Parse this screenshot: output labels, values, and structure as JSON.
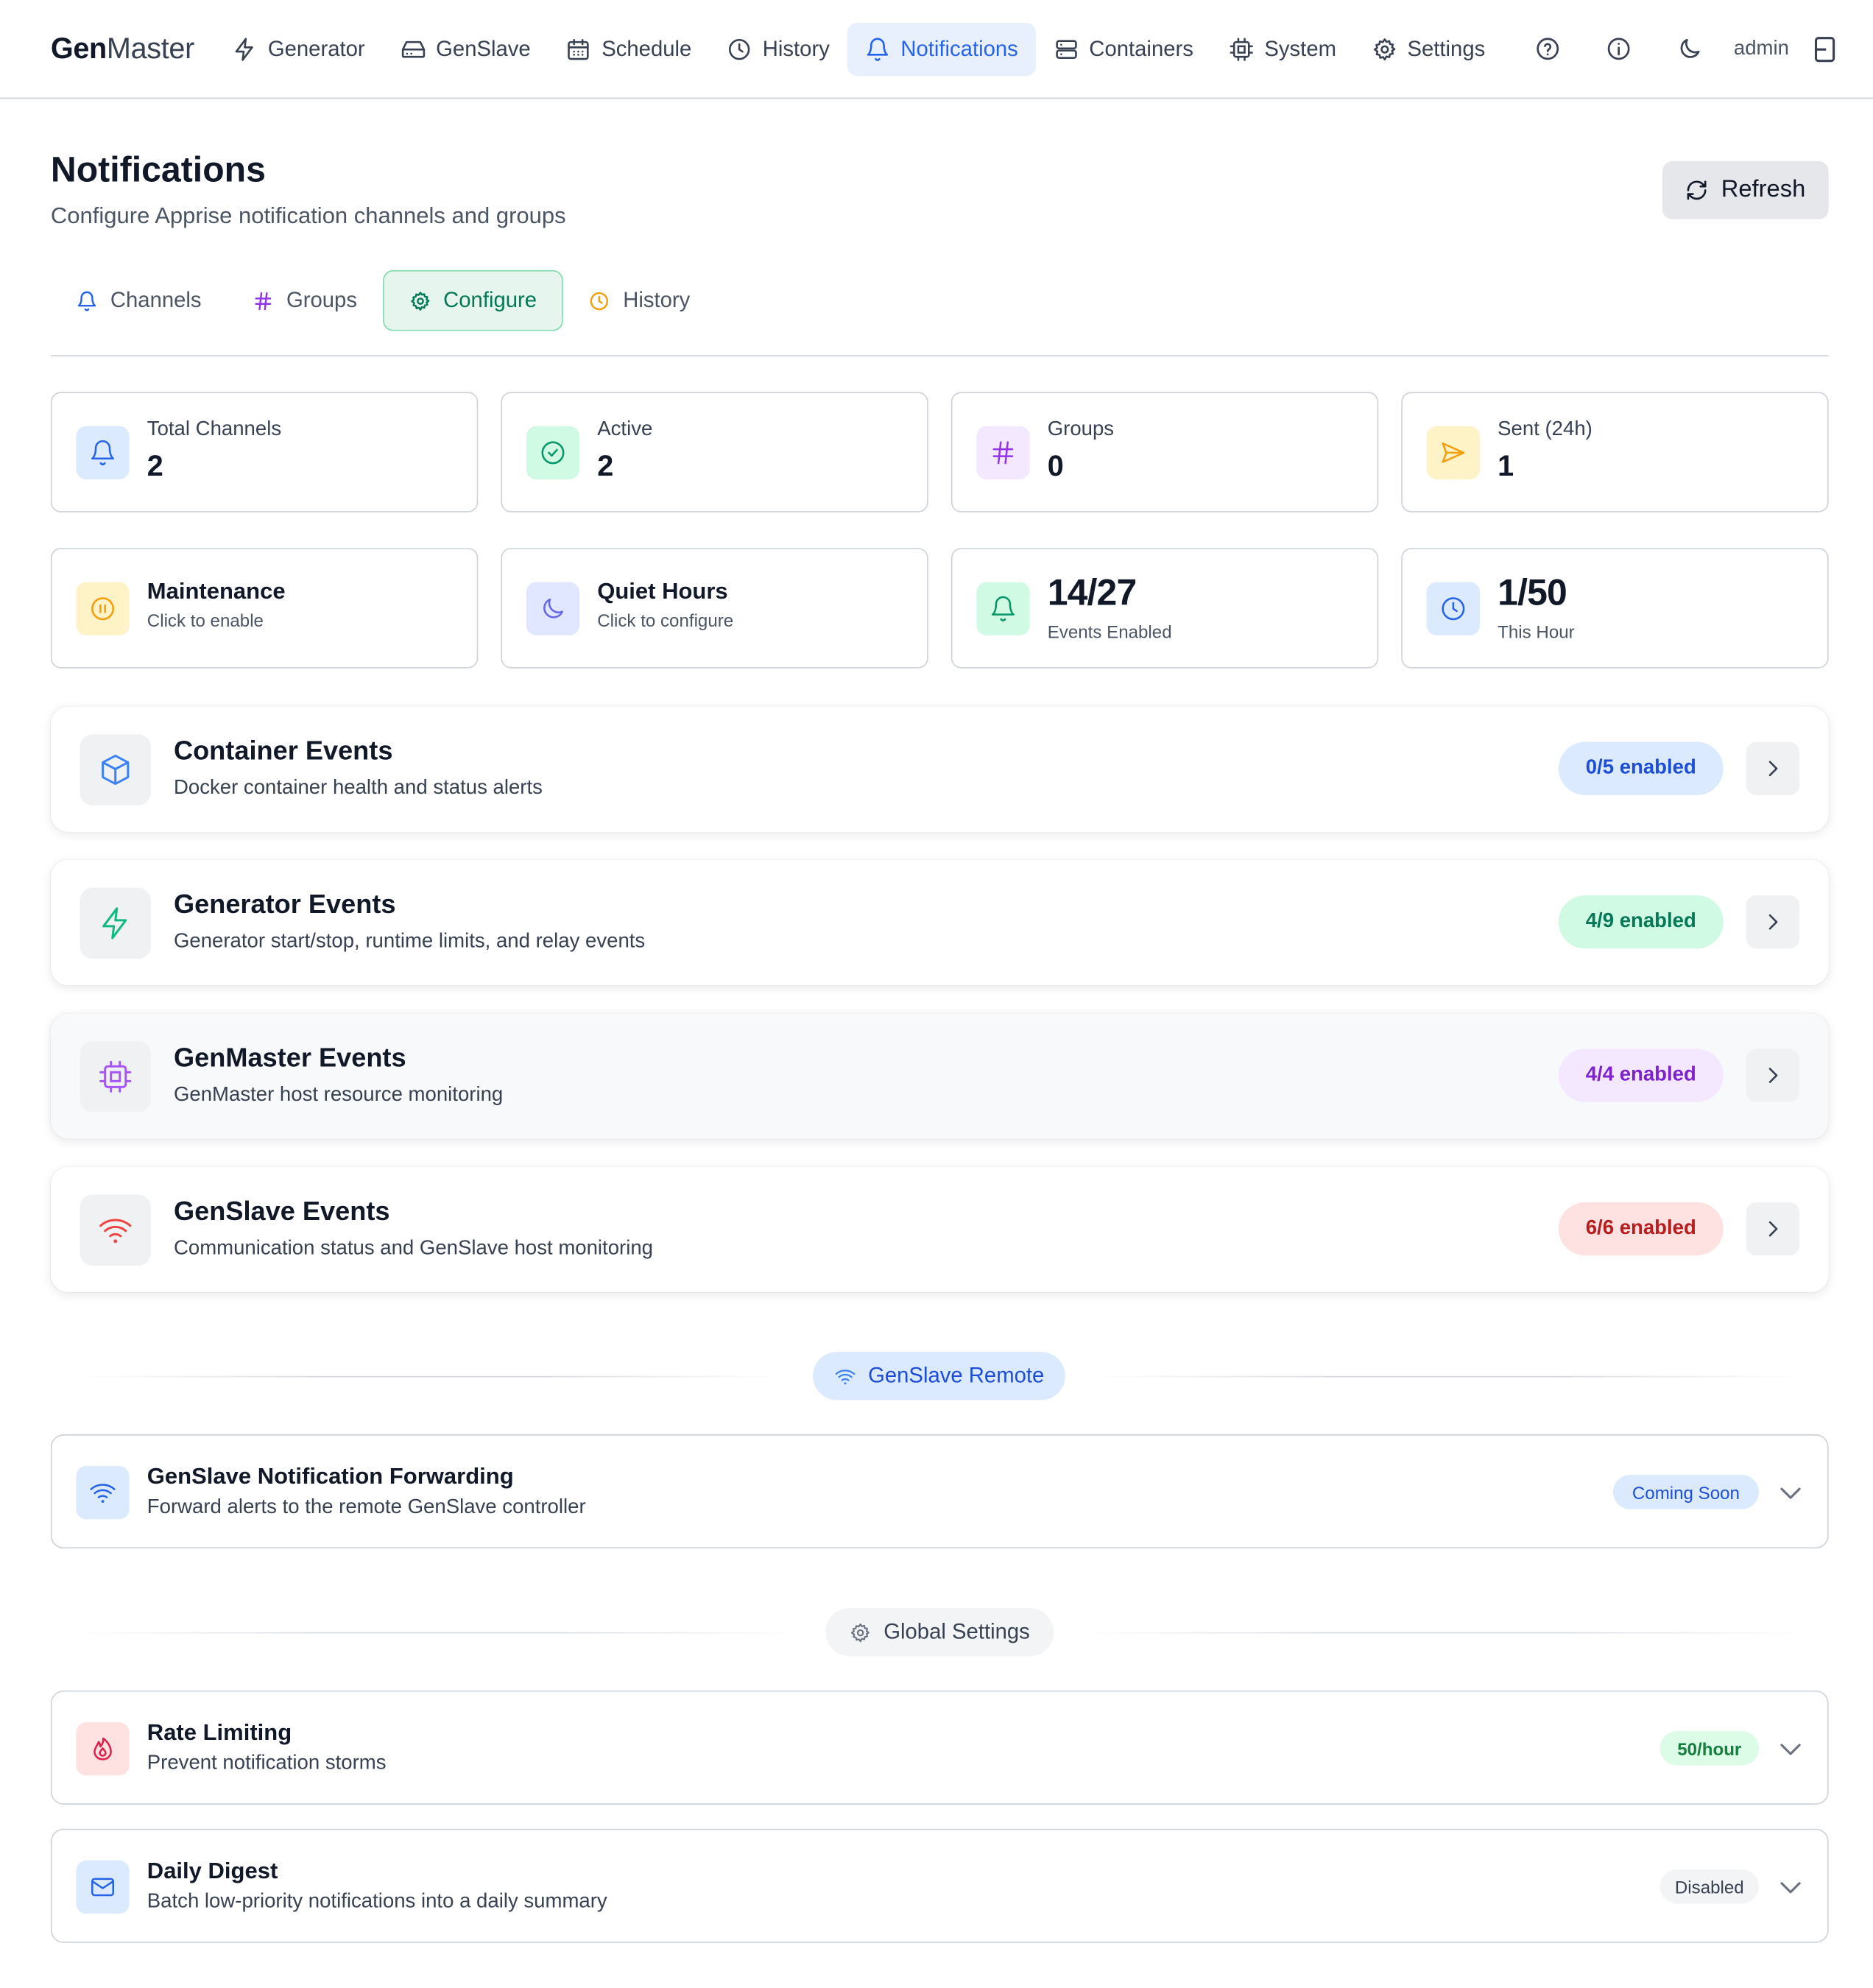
{
  "brand": {
    "bold": "Gen",
    "light": "Master"
  },
  "nav": {
    "items": [
      {
        "label": "Generator",
        "icon": "zap-icon",
        "active": false
      },
      {
        "label": "GenSlave",
        "icon": "hard-drive-icon",
        "active": false
      },
      {
        "label": "Schedule",
        "icon": "calendar-icon",
        "active": false
      },
      {
        "label": "History",
        "icon": "clock-icon",
        "active": false
      },
      {
        "label": "Notifications",
        "icon": "bell-icon",
        "active": true
      },
      {
        "label": "Containers",
        "icon": "server-icon",
        "active": false
      },
      {
        "label": "System",
        "icon": "cpu-icon",
        "active": false
      },
      {
        "label": "Settings",
        "icon": "gear-icon",
        "active": false
      }
    ],
    "icons": [
      "help-circle-icon",
      "info-icon",
      "moon-icon"
    ],
    "user": "admin",
    "logout_icon": "logout-icon"
  },
  "header": {
    "title": "Notifications",
    "subtitle": "Configure Apprise notification channels and groups",
    "refresh_label": "Refresh"
  },
  "tabs": [
    {
      "label": "Channels",
      "icon": "bell-icon",
      "active": false,
      "color": "#2563eb"
    },
    {
      "label": "Groups",
      "icon": "hash-icon",
      "active": false,
      "color": "#9333ea"
    },
    {
      "label": "Configure",
      "icon": "gear-icon",
      "active": true,
      "color": "#047857"
    },
    {
      "label": "History",
      "icon": "clock-icon",
      "active": false,
      "color": "#f59e0b"
    }
  ],
  "stats": [
    {
      "label": "Total Channels",
      "value": "2",
      "icon": "bell-icon",
      "color": "#2563eb",
      "bg": "#dbeafe"
    },
    {
      "label": "Active",
      "value": "2",
      "icon": "check-circle-icon",
      "color": "#059669",
      "bg": "#d1fae5"
    },
    {
      "label": "Groups",
      "value": "0",
      "icon": "hash-icon",
      "color": "#9333ea",
      "bg": "#f3e8ff"
    },
    {
      "label": "Sent (24h)",
      "value": "1",
      "icon": "send-icon",
      "color": "#f59e0b",
      "bg": "#fef3c7"
    }
  ],
  "quick": {
    "maintenance": {
      "title": "Maintenance",
      "sub": "Click to enable",
      "icon": "pause-circle-icon"
    },
    "quiet_hours": {
      "title": "Quiet Hours",
      "sub": "Click to configure",
      "icon": "moon-icon"
    },
    "events_enabled": {
      "value": "14/27",
      "sub": "Events Enabled",
      "icon": "bell-icon"
    },
    "rate": {
      "value": "1/50",
      "sub": "This Hour",
      "icon": "clock-icon"
    }
  },
  "categories": [
    {
      "title": "Container Events",
      "desc": "Docker container health and status alerts",
      "badge": "0/5 enabled",
      "icon": "box-icon",
      "color": "#1d4ed8",
      "bg": "#dbeafe"
    },
    {
      "title": "Generator Events",
      "desc": "Generator start/stop, runtime limits, and relay events",
      "badge": "4/9 enabled",
      "icon": "zap-icon",
      "color": "#047857",
      "bg": "#d1fae5"
    },
    {
      "title": "GenMaster Events",
      "desc": "GenMaster host resource monitoring",
      "badge": "4/4 enabled",
      "icon": "cpu-icon",
      "color": "#7e22ce",
      "bg": "#f3e8ff"
    },
    {
      "title": "GenSlave Events",
      "desc": "Communication status and GenSlave host monitoring",
      "badge": "6/6 enabled",
      "icon": "wifi-icon",
      "color": "#b91c1c",
      "bg": "#fee2e2"
    }
  ],
  "sections": {
    "remote": {
      "label": "GenSlave Remote",
      "icon": "wifi-icon"
    },
    "global": {
      "label": "Global Settings",
      "icon": "gear-icon"
    }
  },
  "forwarding": {
    "title": "GenSlave Notification Forwarding",
    "desc": "Forward alerts to the remote GenSlave controller",
    "badge": "Coming Soon",
    "icon": "wifi-icon"
  },
  "rate_limiting": {
    "title": "Rate Limiting",
    "desc": "Prevent notification storms",
    "badge": "50/hour",
    "icon": "flame-icon"
  },
  "daily_digest": {
    "title": "Daily Digest",
    "desc": "Batch low-priority notifications into a daily summary",
    "badge": "Disabled",
    "icon": "mail-icon"
  }
}
